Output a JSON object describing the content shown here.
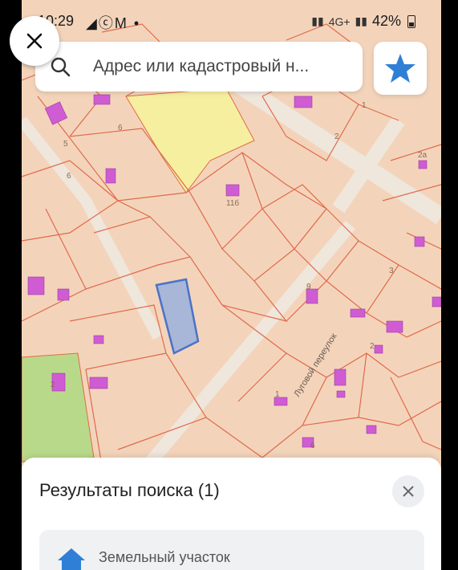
{
  "status_bar": {
    "time": "10:29",
    "app_icons": "◢ⓒM •",
    "network": "4G+",
    "battery": "42%"
  },
  "search": {
    "placeholder": "Адрес или кадастровый н..."
  },
  "map": {
    "street_name": "Луговой переулок",
    "parcel_labels": [
      "6",
      "5",
      "6",
      "2",
      "2а",
      "11б",
      "3",
      "9",
      "2",
      "1",
      "6",
      "2",
      "1"
    ],
    "colors": {
      "parcel_fill": "#f3d4bb",
      "parcel_border": "#e06a4a",
      "building": "#d05cd3",
      "yellow_zone": "#f6efa0",
      "green_zone": "#b9d98a",
      "selected_parcel": "#a8b6d8",
      "selected_border": "#4a72c8"
    }
  },
  "results": {
    "title": "Результаты поиска (1)",
    "item_type": "Земельный участок"
  },
  "accent_color": "#2f7fd6"
}
